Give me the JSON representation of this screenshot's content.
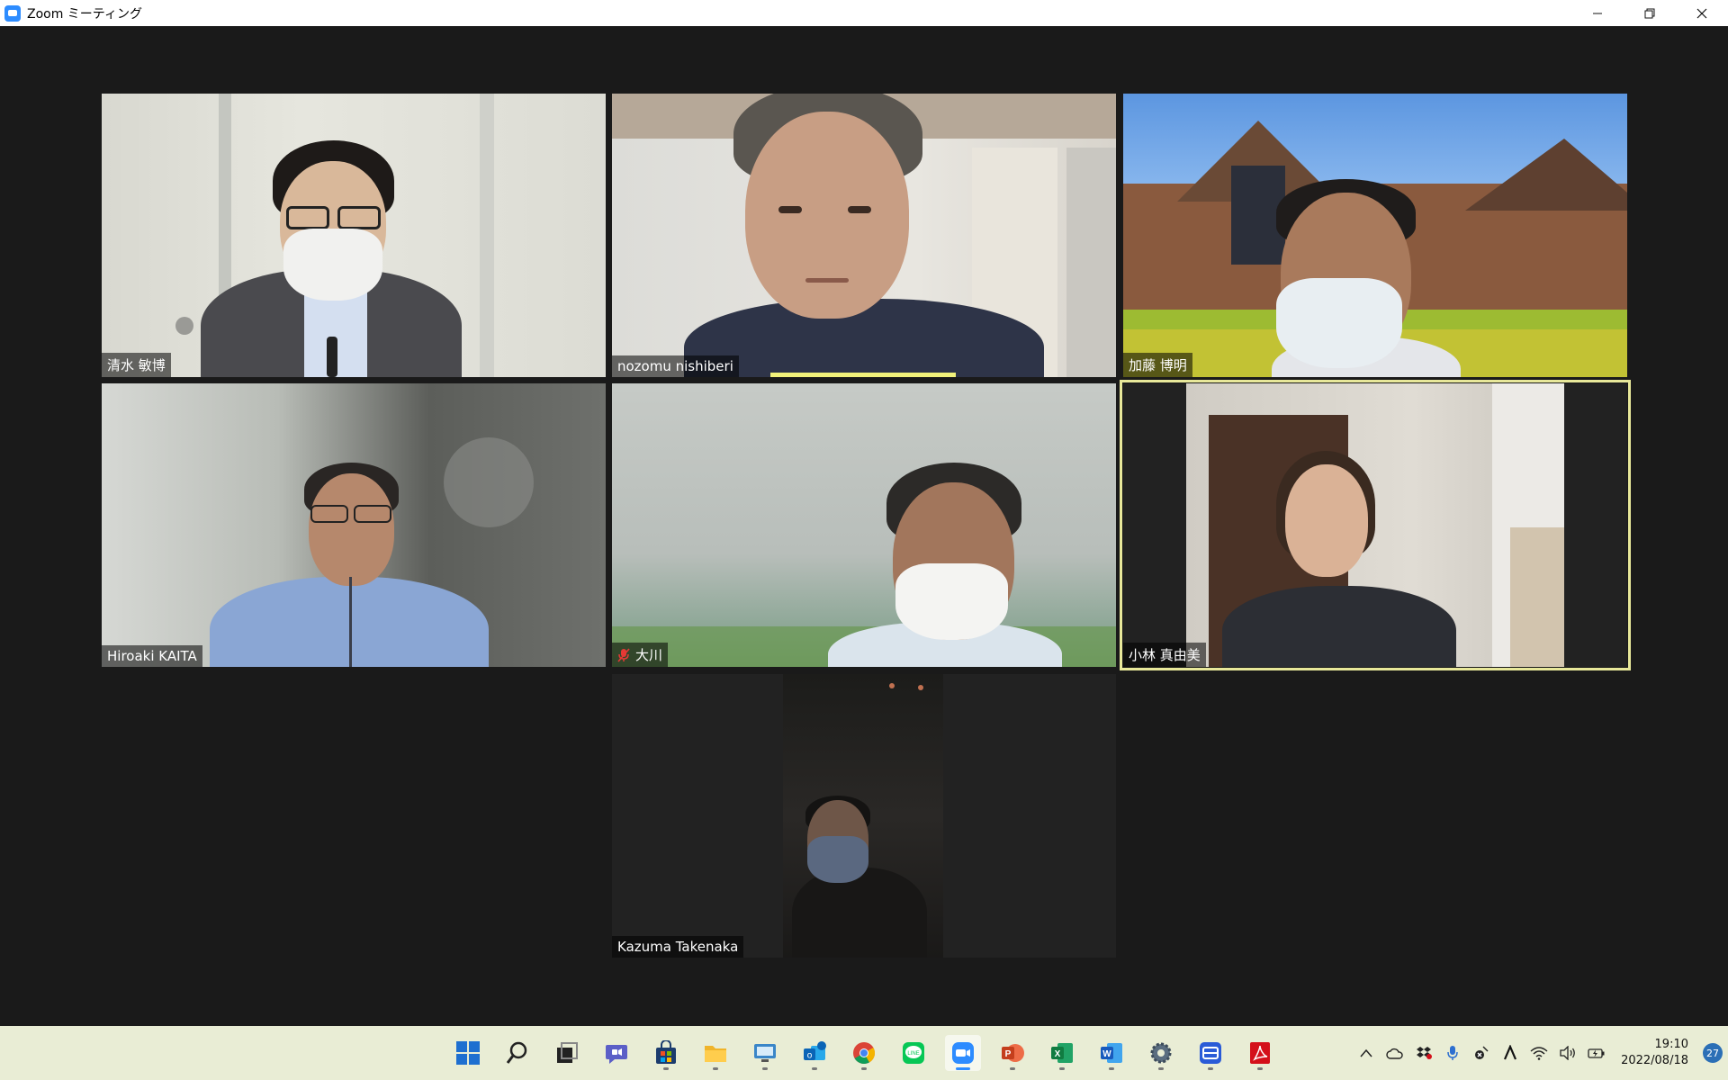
{
  "window": {
    "title": "Zoom ミーティング"
  },
  "participants": [
    {
      "name": "清水 敏博"
    },
    {
      "name": "nozomu nishiberi"
    },
    {
      "name": "加藤 博明"
    },
    {
      "name": "Hiroaki KAITA"
    },
    {
      "name": "大川",
      "muted": true
    },
    {
      "name": "小林 真由美",
      "active_speaker": true
    },
    {
      "name": "Kazuma Takenaka"
    }
  ],
  "taskbar": {
    "apps": [
      "start-icon",
      "search-icon",
      "task-view-icon",
      "teams-chat-icon",
      "store-icon",
      "file-explorer-icon",
      "remote-desktop-icon",
      "outlook-icon",
      "chrome-icon",
      "line-icon",
      "zoom-icon",
      "powerpoint-icon",
      "excel-icon",
      "word-icon",
      "settings-icon",
      "app-icon",
      "acrobat-icon"
    ],
    "active_app": "zoom-icon",
    "time": "19:10",
    "date": "2022/08/18",
    "notifications": "27"
  },
  "colors": {
    "zoom_blue": "#2d8cff",
    "active_speaker_border": "#e8e89a",
    "background": "#1a1a1a",
    "taskbar": "#e9edd5"
  }
}
